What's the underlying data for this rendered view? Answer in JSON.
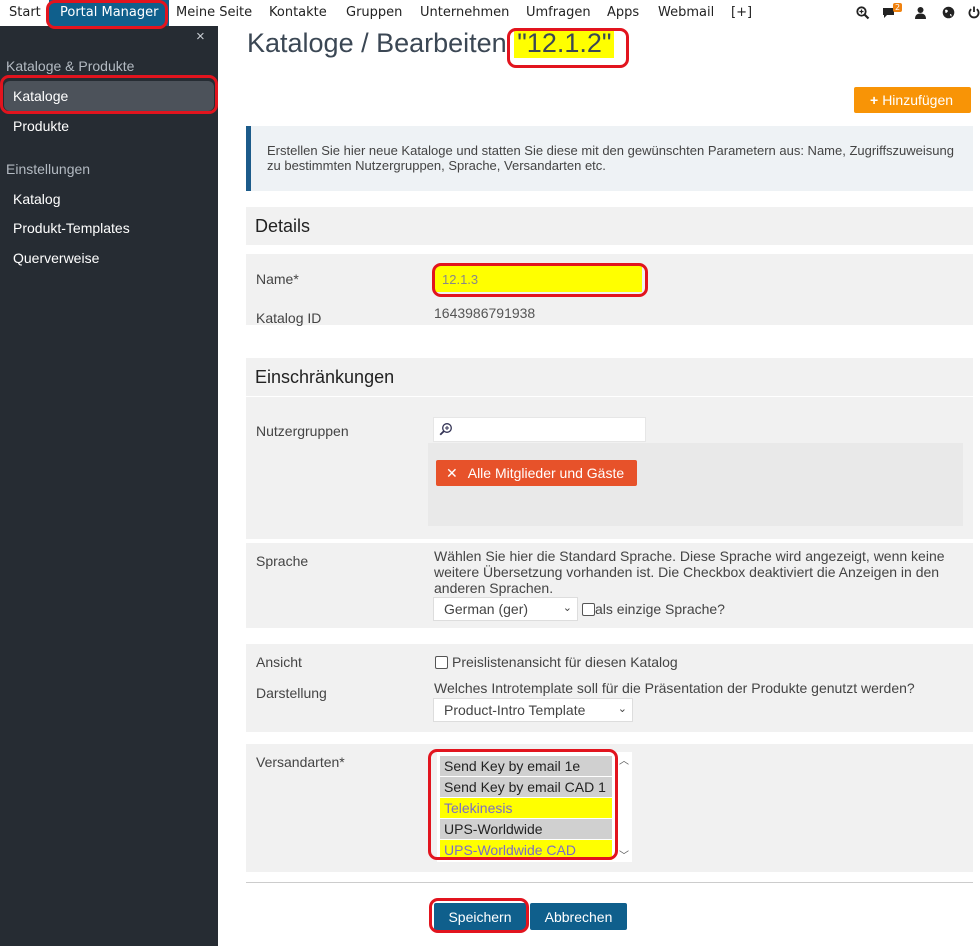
{
  "topnav": {
    "items": [
      "Start",
      "Portal Manager",
      "Meine Seite",
      "Kontakte",
      "Gruppen",
      "Unternehmen",
      "Umfragen",
      "Apps",
      "Webmail",
      "[+]"
    ],
    "active": "Portal Manager",
    "notification_count": "2"
  },
  "sidebar": {
    "close": "×",
    "section1": "Kataloge & Produkte",
    "items1": [
      "Kataloge",
      "Produkte"
    ],
    "section2": "Einstellungen",
    "items2": [
      "Katalog",
      "Produkt-Templates",
      "Querverweise"
    ]
  },
  "page": {
    "title": "Kataloge / Bearbeiten",
    "title_highlight": "\"12.1.2\"",
    "add_button": "Hinzufügen",
    "info_text": "Erstellen Sie hier neue Kataloge und statten Sie diese mit den gewünschten Parametern aus: Name, Zugriffszuweisung zu bestimmten Nutzergruppen, Sprache, Versandarten etc."
  },
  "details": {
    "heading": "Details",
    "name_label": "Name*",
    "name_value": "12.1.3",
    "id_label": "Katalog ID",
    "id_value": "1643986791938"
  },
  "restrictions": {
    "heading": "Einschränkungen",
    "groups_label": "Nutzergruppen",
    "group_tag": "Alle Mitglieder und Gäste",
    "language_label": "Sprache",
    "language_text": "Wählen Sie hier die Standard Sprache. Diese Sprache wird angezeigt, wenn keine weitere Übersetzung vorhanden ist. Die Checkbox deaktiviert die Anzeigen in den anderen Sprachen.",
    "language_selected": "German (ger)",
    "language_only_label": "als einzige Sprache?",
    "view_label": "Ansicht",
    "view_checkbox_label": "Preislistenansicht für diesen Katalog",
    "display_label": "Darstellung",
    "display_question": "Welches Introtemplate soll für die Präsentation der Produkte genutzt werden?",
    "display_selected": "Product-Intro Template",
    "shipping_label": "Versandarten*",
    "shipping_options": [
      "Send Key by email 1e",
      "Send Key by email CAD 1",
      "Telekinesis",
      "UPS-Worldwide",
      "UPS-Worldwide CAD"
    ]
  },
  "actions": {
    "save": "Speichern",
    "cancel": "Abbrechen"
  },
  "colors": {
    "primary": "#0f5f8c",
    "orange": "#f89406",
    "tag": "#e7522a",
    "highlight": "#ffff00",
    "annotation": "#e2141e",
    "sidebar": "#262c33"
  }
}
